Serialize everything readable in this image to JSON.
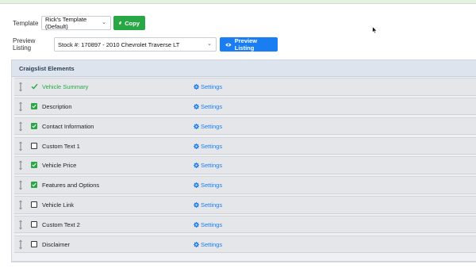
{
  "template": {
    "label": "Template",
    "selected": "Rick's Template (Default)",
    "copy_label": "Copy"
  },
  "preview": {
    "label": "Preview Listing",
    "selected": "Stock #: 170897 - 2010 Chevrolet Traverse LT",
    "button_label": "Preview Listing"
  },
  "panel": {
    "title": "Craigslist Elements",
    "settings_label": "Settings",
    "elements": [
      {
        "name": "Vehicle Summary",
        "checked": true,
        "style": "checkmark"
      },
      {
        "name": "Description",
        "checked": true
      },
      {
        "name": "Contact Information",
        "checked": true
      },
      {
        "name": "Custom Text 1",
        "checked": false
      },
      {
        "name": "Vehicle Price",
        "checked": true
      },
      {
        "name": "Features and Options",
        "checked": true
      },
      {
        "name": "Vehicle Link",
        "checked": false
      },
      {
        "name": "Custom Text 2",
        "checked": false
      },
      {
        "name": "Disclaimer",
        "checked": false
      }
    ]
  },
  "colors": {
    "accent_green": "#28a745",
    "accent_blue": "#1a7ef2",
    "panel_header": "#dde4ee"
  },
  "icons": {
    "copy": "copy-icon",
    "preview": "eye-icon",
    "settings": "gear-icon",
    "drag": "drag-handle-icon"
  }
}
